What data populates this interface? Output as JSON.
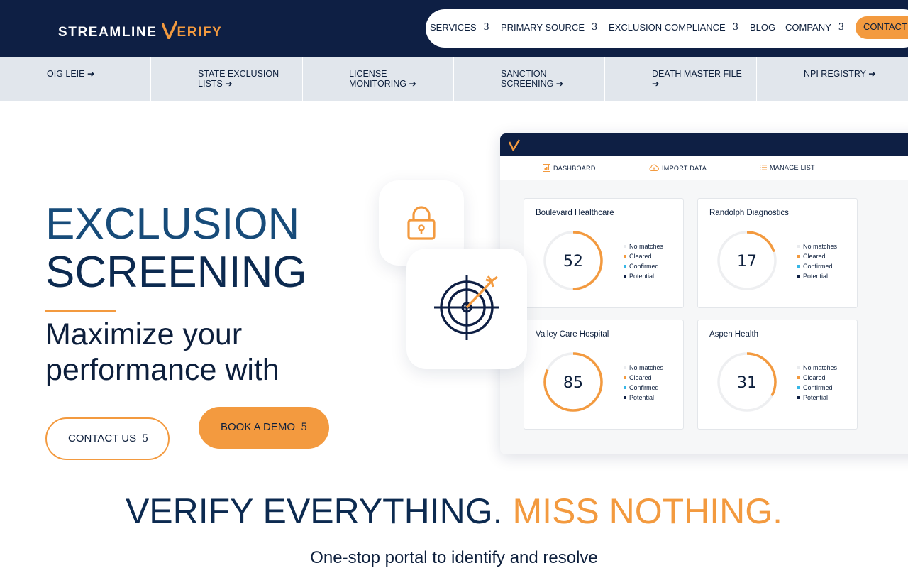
{
  "header": {
    "logo_part1": "STREAMLINE",
    "logo_part2": "ERIFY",
    "nav": [
      {
        "label": "SERVICES",
        "arrow": "3"
      },
      {
        "label": "PRIMARY SOURCE",
        "arrow": "3"
      },
      {
        "label": "EXCLUSION COMPLIANCE",
        "arrow": "3"
      },
      {
        "label": "BLOG",
        "arrow": ""
      },
      {
        "label": "COMPANY",
        "arrow": "3"
      }
    ],
    "contact_label": "CONTACT"
  },
  "subnav": [
    {
      "label": "OIG LEIE ➔"
    },
    {
      "label": "STATE EXCLUSION LISTS ➔"
    },
    {
      "label": "LICENSE MONITORING ➔"
    },
    {
      "label": "SANCTION SCREENING ➔"
    },
    {
      "label": "DEATH MASTER FILE ➔"
    },
    {
      "label": "NPI REGISTRY ➔"
    }
  ],
  "hero": {
    "title_line1": "EXCLUSION",
    "title_line2": "SCREENING",
    "subtitle": "Maximize your performance with",
    "contact_button": "CONTACT US",
    "demo_button": "BOOK A DEMO",
    "button_glyph": "5"
  },
  "dashboard": {
    "tabs": [
      {
        "label": "DASHBOARD",
        "icon": "chart-icon"
      },
      {
        "label": "IMPORT DATA",
        "icon": "cloud-upload-icon"
      },
      {
        "label": "MANAGE LIST",
        "icon": "list-icon"
      }
    ],
    "legend": [
      {
        "label": "No matches",
        "color": "#e9ebee"
      },
      {
        "label": "Cleared",
        "color": "#f39a3f"
      },
      {
        "label": "Confirmed",
        "color": "#37b6e6"
      },
      {
        "label": "Potential",
        "color": "#0e1f44"
      }
    ],
    "cards": [
      {
        "name": "Boulevard Healthcare",
        "value": "52",
        "fill": 0.5
      },
      {
        "name": "Randolph Diagnostics",
        "value": "17",
        "fill": 0.2
      },
      {
        "name": "Valley Care Hospital",
        "value": "85",
        "fill": 0.82
      },
      {
        "name": "Aspen Health",
        "value": "31",
        "fill": 0.33
      }
    ]
  },
  "tagline": {
    "part1": "VERIFY EVERYTHING.",
    "part2": "MISS NOTHING.",
    "sub": "One-stop portal to identify and resolve"
  },
  "colors": {
    "navy": "#0e1f44",
    "orange": "#f39a3f",
    "blue": "#174b79",
    "light_gray": "#e1e6ec"
  }
}
